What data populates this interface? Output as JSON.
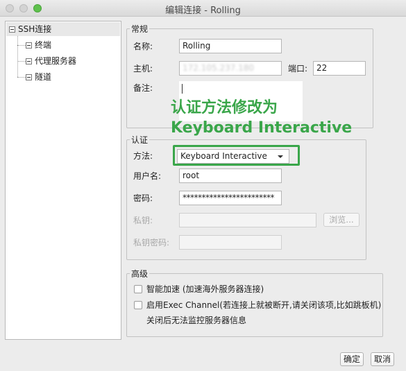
{
  "window": {
    "title": "编辑连接 - Rolling"
  },
  "tree": {
    "items": [
      {
        "label": "SSH连接"
      },
      {
        "label": "终端"
      },
      {
        "label": "代理服务器"
      },
      {
        "label": "隧道"
      }
    ]
  },
  "general": {
    "legend": "常规",
    "name_label": "名称:",
    "name_value": "Rolling",
    "host_label": "主机:",
    "host_value": "172.105.237.180",
    "port_label": "端口:",
    "port_value": "22",
    "note_label": "备注:",
    "note_value": ""
  },
  "annotation": {
    "line1": "认证方法修改为",
    "line2": "Keyboard Interactive",
    "color": "#3aa64a"
  },
  "auth": {
    "legend": "认证",
    "method_label": "方法:",
    "method_value": "Keyboard Interactive",
    "user_label": "用户名:",
    "user_value": "root",
    "password_label": "密码:",
    "password_value": "************************",
    "key_label": "私钥:",
    "key_value": "",
    "browse_label": "浏览...",
    "key_password_label": "私钥密码:",
    "key_password_value": ""
  },
  "advanced": {
    "legend": "高级",
    "smart_accel_label": "智能加速 (加速海外服务器连接)",
    "exec_channel_label": "启用Exec Channel(若连接上就被断开,请关闭该项,比如跳板机)",
    "exec_channel_hint": "关闭后无法监控服务器信息"
  },
  "buttons": {
    "ok": "确定",
    "cancel": "取消"
  }
}
